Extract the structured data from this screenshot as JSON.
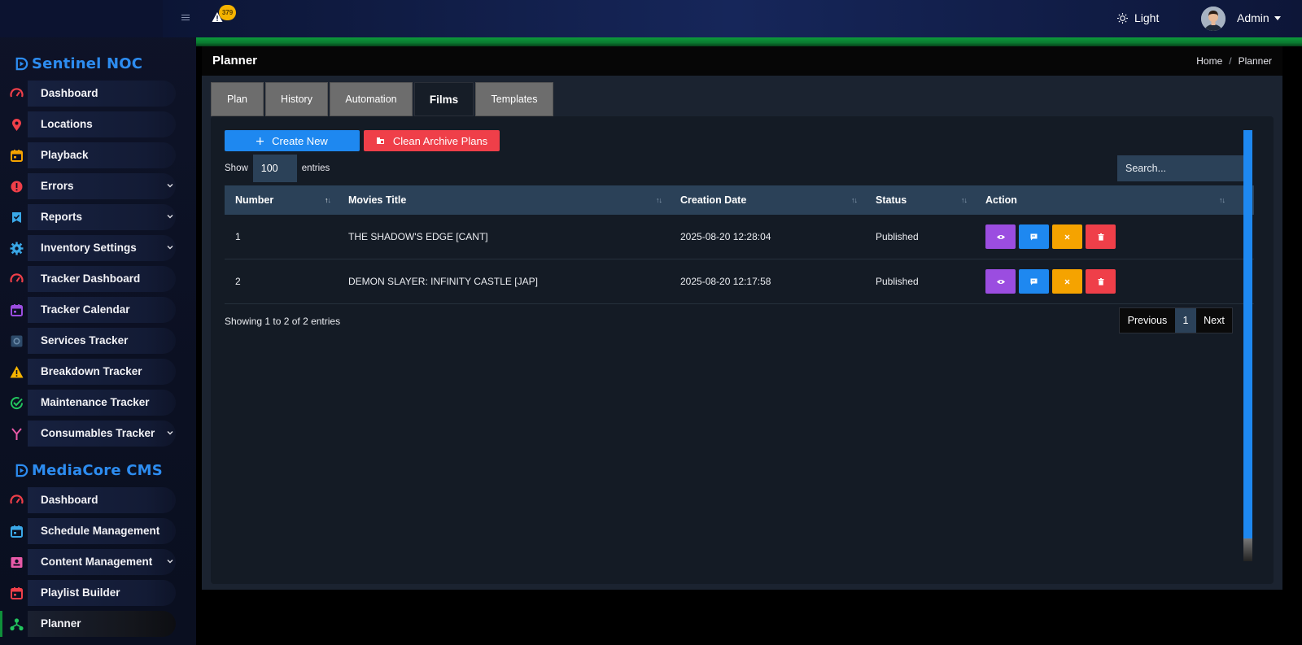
{
  "topbar": {
    "notifications_count": "379",
    "theme_label": "Light",
    "user_label": "Admin"
  },
  "sidebar": {
    "brand1": "Sentinel NOC",
    "brand2": "MediaCore CMS",
    "group1": [
      {
        "label": "Dashboard",
        "icon": "speedometer-icon",
        "color": "#ef3f49",
        "chevron": false
      },
      {
        "label": "Locations",
        "icon": "map-pin-icon",
        "color": "#ef3f49",
        "chevron": false
      },
      {
        "label": "Playback",
        "icon": "calendar-icon",
        "color": "#f5a300",
        "chevron": false
      },
      {
        "label": "Errors",
        "icon": "alert-circle-icon",
        "color": "#ef3f49",
        "chevron": true
      },
      {
        "label": "Reports",
        "icon": "check-badge-icon",
        "color": "#3aa8e8",
        "chevron": true
      },
      {
        "label": "Inventory Settings",
        "icon": "gear-icon",
        "color": "#3aa8e8",
        "chevron": true
      },
      {
        "label": "Tracker Dashboard",
        "icon": "speedometer-icon",
        "color": "#ef3f49",
        "chevron": false
      },
      {
        "label": "Tracker Calendar",
        "icon": "calendar-icon",
        "color": "#9b4de0",
        "chevron": false
      },
      {
        "label": "Services Tracker",
        "icon": "settings-square-icon",
        "color": "#2d4a6a",
        "chevron": false
      },
      {
        "label": "Breakdown Tracker",
        "icon": "warning-triangle-icon",
        "color": "#f5b300",
        "chevron": false
      },
      {
        "label": "Maintenance Tracker",
        "icon": "check-circle-icon",
        "color": "#22c55e",
        "chevron": false
      },
      {
        "label": "Consumables Tracker",
        "icon": "fork-icon",
        "color": "#e85aa8",
        "chevron": true
      }
    ],
    "group2": [
      {
        "label": "Dashboard",
        "icon": "speedometer-icon",
        "color": "#ef3f49",
        "chevron": false
      },
      {
        "label": "Schedule Management",
        "icon": "calendar-icon",
        "color": "#3aa8e8",
        "chevron": false
      },
      {
        "label": "Content Management",
        "icon": "id-card-icon",
        "color": "#e85aa8",
        "chevron": true
      },
      {
        "label": "Playlist Builder",
        "icon": "calendar-icon",
        "color": "#ef3f49",
        "chevron": false
      },
      {
        "label": "Planner",
        "icon": "hierarchy-icon",
        "color": "#22c55e",
        "chevron": false,
        "active": true
      }
    ]
  },
  "header": {
    "title": "Planner",
    "breadcrumb_home": "Home",
    "breadcrumb_sep": "/",
    "breadcrumb_current": "Planner"
  },
  "tabs": [
    {
      "label": "Plan",
      "active": false
    },
    {
      "label": "History",
      "active": false
    },
    {
      "label": "Automation",
      "active": false
    },
    {
      "label": "Films",
      "active": true
    },
    {
      "label": "Templates",
      "active": false
    }
  ],
  "toolbar": {
    "create_label": "Create New",
    "clean_label": "Clean Archive Plans",
    "show_label": "Show",
    "entries_value": "100",
    "entries_label": "entries",
    "search_placeholder": "Search..."
  },
  "table": {
    "columns": [
      "Number",
      "Movies Title",
      "Creation Date",
      "Status",
      "Action"
    ],
    "rows": [
      {
        "number": "1",
        "title": "THE SHADOW'S EDGE [CANT]",
        "date": "2025-08-20 12:28:04",
        "status": "Published"
      },
      {
        "number": "2",
        "title": "DEMON SLAYER: INFINITY CASTLE [JAP]",
        "date": "2025-08-20 12:17:58",
        "status": "Published"
      }
    ]
  },
  "footer": {
    "showing": "Showing 1 to 2 of 2 entries",
    "prev": "Previous",
    "page": "1",
    "next": "Next"
  }
}
